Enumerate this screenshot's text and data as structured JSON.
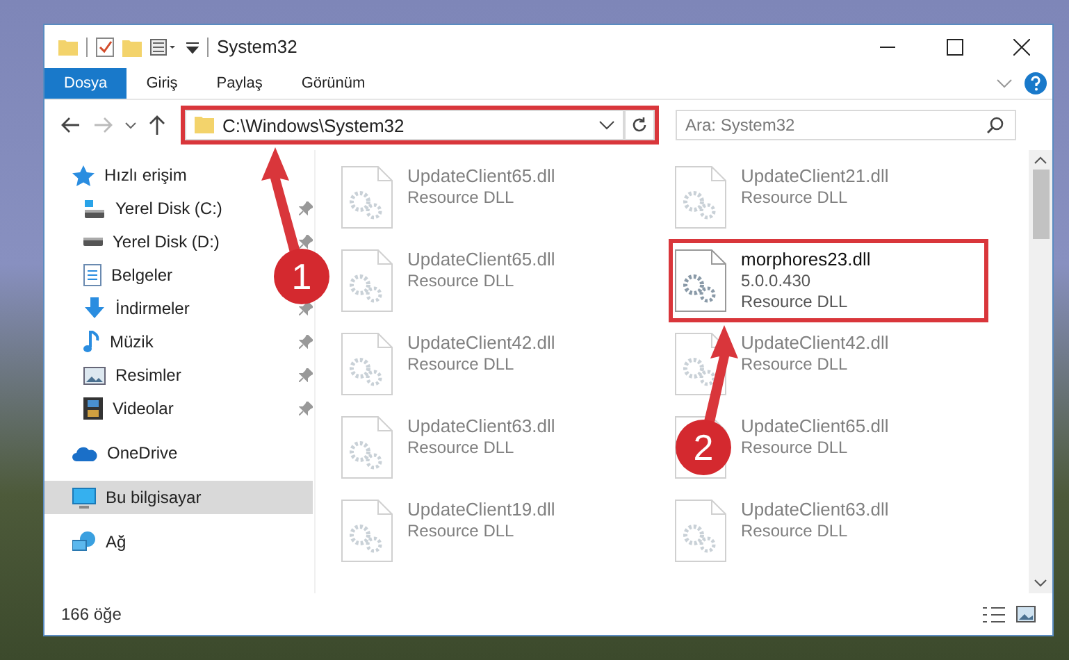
{
  "window": {
    "title": "System32"
  },
  "ribbon_tabs": [
    {
      "label": "Dosya",
      "selected": true
    },
    {
      "label": "Giriş",
      "selected": false
    },
    {
      "label": "Paylaş",
      "selected": false
    },
    {
      "label": "Görünüm",
      "selected": false
    }
  ],
  "address_bar": {
    "path": "C:\\Windows\\System32",
    "highlighted": true
  },
  "search": {
    "placeholder": "Ara: System32"
  },
  "sidebar": {
    "items": [
      {
        "label": "Hızlı erişim",
        "kind": "star",
        "selected": false,
        "group_start": true
      },
      {
        "label": "Yerel Disk (C:)",
        "kind": "drive-c",
        "pinned": true,
        "selected": false
      },
      {
        "label": "Yerel Disk (D:)",
        "kind": "drive",
        "pinned": true,
        "selected": false
      },
      {
        "label": "Belgeler",
        "kind": "document",
        "selected": false
      },
      {
        "label": "İndirmeler",
        "kind": "download",
        "pinned": true,
        "selected": false
      },
      {
        "label": "Müzik",
        "kind": "music",
        "pinned": true,
        "selected": false
      },
      {
        "label": "Resimler",
        "kind": "pictures",
        "pinned": true,
        "selected": false
      },
      {
        "label": "Videolar",
        "kind": "video",
        "pinned": true,
        "selected": false
      },
      {
        "label": "OneDrive",
        "kind": "cloud",
        "selected": false,
        "group_start": true
      },
      {
        "label": "Bu bilgisayar",
        "kind": "computer",
        "selected": true,
        "group_start": true
      },
      {
        "label": "Ağ",
        "kind": "network",
        "selected": false,
        "group_start": true
      }
    ]
  },
  "files": [
    {
      "name": "UpdateClient65.dll",
      "type": "Resource DLL",
      "faded": true,
      "highlighted": false
    },
    {
      "name": "UpdateClient21.dll",
      "type": "Resource DLL",
      "faded": true,
      "highlighted": false
    },
    {
      "name": "UpdateClient65.dll",
      "type": "Resource DLL",
      "faded": true,
      "highlighted": false
    },
    {
      "name": "morphores23.dll",
      "version": "5.0.0.430",
      "type": "Resource DLL",
      "faded": false,
      "highlighted": true
    },
    {
      "name": "UpdateClient42.dll",
      "type": "Resource DLL",
      "faded": true,
      "highlighted": false
    },
    {
      "name": "UpdateClient42.dll",
      "type": "Resource DLL",
      "faded": true,
      "highlighted": false
    },
    {
      "name": "UpdateClient63.dll",
      "type": "Resource DLL",
      "faded": true,
      "highlighted": false
    },
    {
      "name": "UpdateClient65.dll",
      "type": "Resource DLL",
      "faded": true,
      "highlighted": false
    },
    {
      "name": "UpdateClient19.dll",
      "type": "Resource DLL",
      "faded": true,
      "highlighted": false
    },
    {
      "name": "UpdateClient63.dll",
      "type": "Resource DLL",
      "faded": true,
      "highlighted": false
    }
  ],
  "status_bar": {
    "item_count": "166 öğe"
  },
  "annotations": [
    {
      "number": "1"
    },
    {
      "number": "2"
    }
  ]
}
